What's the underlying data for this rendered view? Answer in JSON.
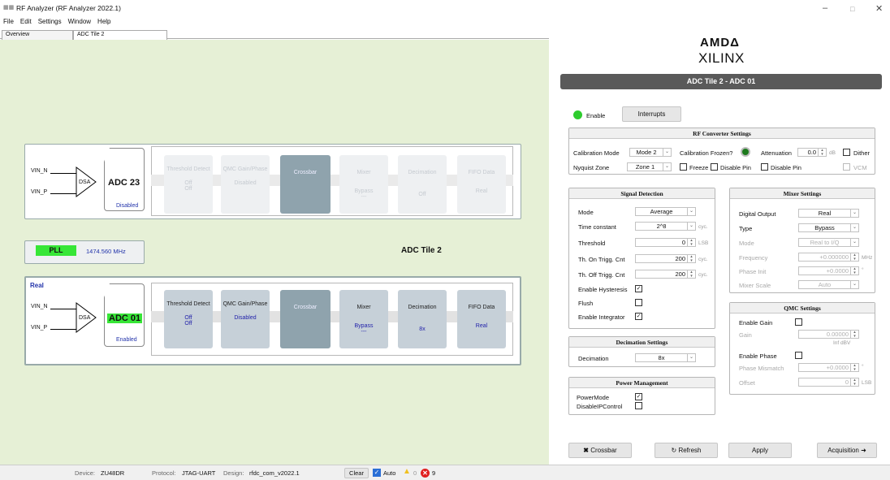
{
  "window": {
    "title": "RF Analyzer (RF Analyzer 2022.1)",
    "icon": "app-icon",
    "minimize": "–",
    "maximize": "□",
    "close": "✕"
  },
  "menu": [
    "File",
    "Edit",
    "Settings",
    "Window",
    "Help"
  ],
  "tabs": [
    "Overview",
    "ADC Tile 2"
  ],
  "diagram": {
    "top_tile": {
      "vin_n": "VIN_N",
      "vin_p": "VIN_P",
      "dsa": "DSA",
      "adc": "ADC 23",
      "adc_status": "Disabled",
      "blocks": [
        {
          "title": "Threshold Detect",
          "s1": "Off",
          "s2": "Off"
        },
        {
          "title": "QMC Gain/Phase",
          "s1": "",
          "s2": "Disabled"
        },
        {
          "title": "Crossbar",
          "s1": "",
          "s2": ""
        },
        {
          "title": "Mixer",
          "s1": "Bypass",
          "s2": "---"
        },
        {
          "title": "Decimation",
          "s1": "",
          "s2": "Off"
        },
        {
          "title": "FIFO Data",
          "s1": "",
          "s2": "Real"
        }
      ]
    },
    "pll": {
      "label": "PLL",
      "freq": "1474.560 MHz"
    },
    "tile_name": "ADC Tile 2",
    "bottom_tile": {
      "mode": "Real",
      "vin_n": "VIN_N",
      "vin_p": "VIN_P",
      "dsa": "DSA",
      "adc": "ADC 01",
      "adc_status": "Enabled",
      "blocks": [
        {
          "title": "Threshold Detect",
          "s1": "Off",
          "s2": "Off"
        },
        {
          "title": "QMC Gain/Phase",
          "s1": "",
          "s2": "Disabled"
        },
        {
          "title": "Crossbar",
          "s1": "",
          "s2": ""
        },
        {
          "title": "Mixer",
          "s1": "Bypass",
          "s2": "---"
        },
        {
          "title": "Decimation",
          "s1": "",
          "s2": "8x"
        },
        {
          "title": "FIFO Data",
          "s1": "",
          "s2": "Real"
        }
      ]
    }
  },
  "panel": {
    "logo_top": "AMDΔ",
    "logo_bottom": "XILINX",
    "header": "ADC Tile 2 - ADC 01",
    "enable": "Enable",
    "interrupts": "Interrupts",
    "rf": {
      "title": "RF Converter Settings",
      "cal_mode_label": "Calibration Mode",
      "cal_mode": "Mode 2",
      "cal_frozen": "Calibration Frozen?",
      "atten_label": "Attenuation",
      "atten": "0.0",
      "atten_unit": "dB",
      "dither": "Dither",
      "nyquist_label": "Nyquist Zone",
      "nyquist": "Zone 1",
      "freeze": "Freeze",
      "disable_pin1": "Disable Pin",
      "disable_pin2": "Disable Pin",
      "vcm": "VCM"
    },
    "signal": {
      "title": "Signal Detection",
      "mode_label": "Mode",
      "mode": "Average",
      "tc_label": "Time constant",
      "tc": "2^8",
      "tc_unit": "cyc.",
      "th_label": "Threshold",
      "th": "0",
      "th_unit": "LSB",
      "on_label": "Th. On Trigg. Cnt",
      "on": "200",
      "on_unit": "cyc.",
      "off_label": "Th. Off Trigg. Cnt",
      "off": "200",
      "off_unit": "cyc.",
      "hyst": "Enable Hysteresis",
      "flush": "Flush",
      "integ": "Enable Integrator"
    },
    "mixer": {
      "title": "Mixer Settings",
      "out_label": "Digital Output",
      "out": "Real",
      "type_label": "Type",
      "type": "Bypass",
      "mode_label": "Mode",
      "mode": "Real to I/Q",
      "freq_label": "Frequency",
      "freq": "+0.000000",
      "freq_unit": "MHz",
      "phase_label": "Phase Init",
      "phase": "+0.0000",
      "phase_unit": "°",
      "scale_label": "Mixer Scale",
      "scale": "Auto"
    },
    "qmc": {
      "title": "QMC Settings",
      "gain_en": "Enable Gain",
      "gain_label": "Gain",
      "gain": "0.00000",
      "gain_db": "Inf dBV",
      "phase_en": "Enable Phase",
      "pm_label": "Phase Mismatch",
      "pm": "+0.0000",
      "pm_unit": "°",
      "off_label": "Offset",
      "off": "0",
      "off_unit": "LSB"
    },
    "decim": {
      "title": "Decimation Settings",
      "label": "Decimation",
      "value": "8x"
    },
    "power": {
      "title": "Power Management",
      "mode": "PowerMode",
      "disable": "DisableIPControl"
    },
    "buttons": {
      "crossbar": "Crossbar",
      "refresh": "Refresh",
      "apply": "Apply",
      "acquisition": "Acquisition"
    }
  },
  "status": {
    "device_label": "Device:",
    "device": "ZU48DR",
    "protocol_label": "Protocol:",
    "protocol": "JTAG-UART",
    "design_label": "Design:",
    "design": "rfdc_com_v2022.1",
    "clear": "Clear",
    "auto": "Auto",
    "warnings": "0",
    "errors": "9"
  },
  "colors": {
    "enable_led": "#2ecc2e",
    "frozen_led": "#1d7a1d",
    "pll_green": "#37e637",
    "adc_green": "#37e637",
    "header": "#5a5a5a",
    "error_red": "#e02020"
  }
}
